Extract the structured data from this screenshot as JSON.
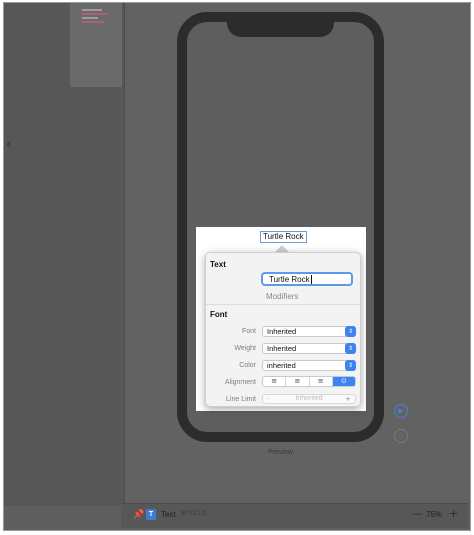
{
  "sidebar": {
    "collapse_icon": "chevron-left-icon"
  },
  "canvas": {
    "selected_text": "Turtle Rock",
    "preview_label": "Preview"
  },
  "inspector": {
    "text_section": "Text",
    "text_value": "Turtle Rock",
    "modifiers_label": "Modifiers",
    "font_section": "Font",
    "rows": {
      "font": {
        "label": "Font",
        "value": "Inherited"
      },
      "weight": {
        "label": "Weight",
        "value": "Inherited"
      },
      "color": {
        "label": "Color",
        "value": "inherited"
      },
      "alignment": {
        "label": "Alignment"
      },
      "line_limit": {
        "label": "Line Limit",
        "value": "Inherited",
        "minus": "-",
        "plus": "+"
      }
    },
    "alignment_options": [
      "left",
      "center",
      "right",
      "inherited"
    ],
    "alignment_selected": "inherited"
  },
  "bottom_bar": {
    "element_name": "Text",
    "element_size": "87×21.5",
    "zoom": "75%",
    "zoom_out": "—",
    "zoom_in": "+"
  },
  "colors": {
    "accent": "#3e84f0",
    "phone_frame": "#2c2c2c",
    "canvas": "#626262"
  }
}
